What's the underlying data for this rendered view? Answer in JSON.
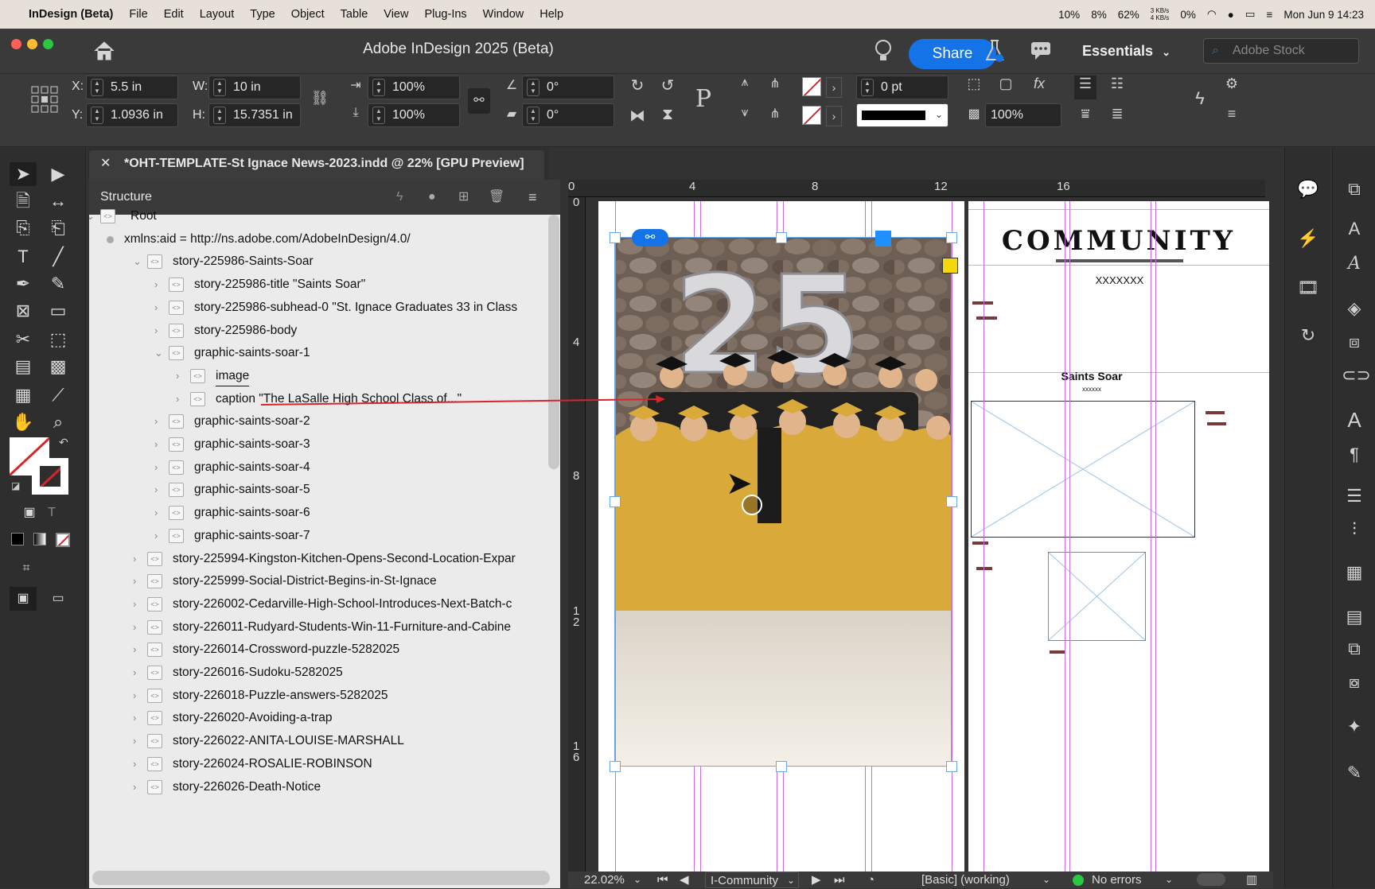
{
  "menubar": {
    "app": "InDesign (Beta)",
    "items": [
      "File",
      "Edit",
      "Layout",
      "Type",
      "Object",
      "Table",
      "View",
      "Plug-Ins",
      "Window",
      "Help"
    ],
    "status": {
      "cpu1": "10%",
      "cpu2": "8%",
      "mem": "62%",
      "net": "3 KB/s\n4 KB/s",
      "battery": "0%",
      "datetime": "Mon Jun 9  14:23"
    }
  },
  "titlebar": {
    "title": "Adobe InDesign 2025 (Beta)",
    "share": "Share",
    "workspace": "Essentials",
    "stock_placeholder": "Adobe Stock"
  },
  "control": {
    "x_label": "X:",
    "x": "5.5 in",
    "y_label": "Y:",
    "y": "1.0936 in",
    "w_label": "W:",
    "w": "10 in",
    "h_label": "H:",
    "h": "15.7351 in",
    "scale_x": "100%",
    "scale_y": "100%",
    "angle": "0°",
    "shear": "0°",
    "stroke_weight": "0 pt",
    "opacity": "100%"
  },
  "document_tab": "*OHT-TEMPLATE-St Ignace News-2023.indd @ 22% [GPU Preview]",
  "structure": {
    "title": "Structure",
    "rows": [
      {
        "text": "Root",
        "depth": 0,
        "expanded": true
      },
      {
        "text": "xmlns:aid = http://ns.adobe.com/AdobeInDesign/4.0/",
        "depth": 1,
        "attr": true
      },
      {
        "text": "story-225986-Saints-Soar",
        "depth": 1,
        "expanded": true
      },
      {
        "text": "story-225986-title  \"Saints Soar\"",
        "depth": 2
      },
      {
        "text": "story-225986-subhead-0  \"St. Ignace Graduates 33 in Class",
        "depth": 2
      },
      {
        "text": "story-225986-body",
        "depth": 2
      },
      {
        "text": "graphic-saints-soar-1",
        "depth": 2,
        "expanded": true
      },
      {
        "text": "image",
        "depth": 3,
        "selected": true
      },
      {
        "text": "caption  \"The LaSalle High School Class of...\"",
        "depth": 3
      },
      {
        "text": "graphic-saints-soar-2",
        "depth": 2
      },
      {
        "text": "graphic-saints-soar-3",
        "depth": 2
      },
      {
        "text": "graphic-saints-soar-4",
        "depth": 2
      },
      {
        "text": "graphic-saints-soar-5",
        "depth": 2
      },
      {
        "text": "graphic-saints-soar-6",
        "depth": 2
      },
      {
        "text": "graphic-saints-soar-7",
        "depth": 2
      },
      {
        "text": "story-225994-Kingston-Kitchen-Opens-Second-Location-Expar",
        "depth": 1
      },
      {
        "text": "story-225999-Social-District-Begins-in-St-Ignace",
        "depth": 1
      },
      {
        "text": "story-226002-Cedarville-High-School-Introduces-Next-Batch-c",
        "depth": 1
      },
      {
        "text": "story-226011-Rudyard-Students-Win-11-Furniture-and-Cabine",
        "depth": 1
      },
      {
        "text": "story-226014-Crossword-puzzle-5282025",
        "depth": 1
      },
      {
        "text": "story-226016-Sudoku-5282025",
        "depth": 1
      },
      {
        "text": "story-226018-Puzzle-answers-5282025",
        "depth": 1
      },
      {
        "text": "story-226020-Avoiding-a-trap",
        "depth": 1
      },
      {
        "text": "story-226022-ANITA-LOUISE-MARSHALL",
        "depth": 1
      },
      {
        "text": "story-226024-ROSALIE-ROBINSON",
        "depth": 1
      },
      {
        "text": "story-226026-Death-Notice",
        "depth": 1
      }
    ]
  },
  "rulers": {
    "h": [
      "0",
      "4",
      "8",
      "12",
      "16"
    ],
    "v": [
      "0",
      "4",
      "8",
      "1\n2",
      "1\n6"
    ]
  },
  "page2": {
    "heading": "COMMUNITY",
    "sub": "XXXXXXX",
    "story_title": "Saints Soar",
    "story_sub": "xxxxxx"
  },
  "photo": {
    "balloons": "25"
  },
  "statusbar": {
    "zoom": "22.02%",
    "page": "I-Community",
    "profile": "[Basic] (working)",
    "errors": "No errors"
  },
  "colors": {
    "accent": "#1473e6",
    "guide": "#c86ee0",
    "selection": "#6aa8e8",
    "arrow": "#d6262b"
  }
}
